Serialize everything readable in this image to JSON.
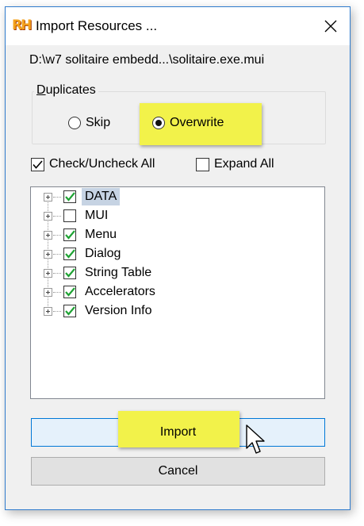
{
  "window": {
    "app_icon_text": "RH",
    "title": "Import Resources ..."
  },
  "file_path": "D:\\w7 solitaire embedd...\\solitaire.exe.mui",
  "duplicates": {
    "group_title_first": "D",
    "group_title_rest": "uplicates",
    "options": [
      {
        "label": "Skip",
        "selected": false
      },
      {
        "label": "Overwrite",
        "selected": true
      }
    ]
  },
  "check_uncheck_all": {
    "label": "Check/Uncheck All",
    "checked": true
  },
  "expand_all": {
    "label": "Expand All",
    "checked": false
  },
  "tree": {
    "items": [
      {
        "label": "DATA",
        "checked": true,
        "selected": true
      },
      {
        "label": "MUI",
        "checked": false,
        "selected": false
      },
      {
        "label": "Menu",
        "checked": true,
        "selected": false
      },
      {
        "label": "Dialog",
        "checked": true,
        "selected": false
      },
      {
        "label": "String Table",
        "checked": true,
        "selected": false
      },
      {
        "label": "Accelerators",
        "checked": true,
        "selected": false
      },
      {
        "label": "Version Info",
        "checked": true,
        "selected": false
      }
    ]
  },
  "buttons": {
    "import_label": "Import",
    "cancel_label": "Cancel"
  },
  "colors": {
    "highlight": "#f2f24a",
    "check_green": "#1fa334",
    "window_border": "#2f7bcd",
    "selection": "#c6d3e3"
  }
}
